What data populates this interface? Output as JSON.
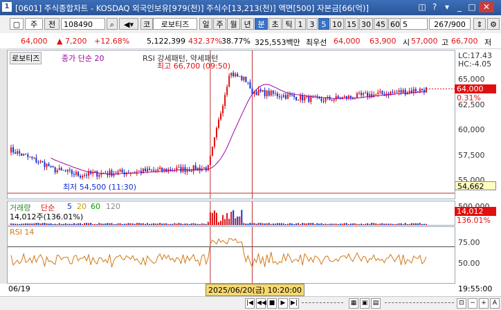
{
  "window": {
    "badge": "1",
    "title": "[0601] 주식종합차트 - KOSDAQ 외국인보유[979(천)] 주식수[13,213(천)] 액면[500] 자본금[66(억)]",
    "close": "✕"
  },
  "toolbar": {
    "market": "주",
    "market_btn": "전",
    "code": "108490",
    "stock_prefix": "코",
    "stock_name": "로보티즈",
    "periods": [
      "일",
      "주",
      "월",
      "년",
      "분",
      "초",
      "틱"
    ],
    "active_period": "분",
    "intervals": [
      "1",
      "3",
      "5",
      "10",
      "15",
      "30",
      "45",
      "60"
    ],
    "active_interval": "5",
    "interval_select": "5",
    "count": "267/900"
  },
  "quote": {
    "price": "64,000",
    "change": "▲ 7,200",
    "change_pct": "+12.68%",
    "volume": "5,122,399",
    "vol_ratio": "432.37%",
    "turnover": "38.77%",
    "amount": "325,553백만",
    "best_label": "최우선",
    "ask": "64,000",
    "bid": "63,900",
    "open_label": "시",
    "open": "57,000",
    "high_label": "고",
    "high": "66,700",
    "low_label": "저"
  },
  "price_panel": {
    "legend_name": "로보티즈",
    "legend_ma": "종가 단순 20",
    "legend_ind": "RSI 강세패턴, 약세패턴",
    "high_annot": "최고 66,700 (09:50)",
    "low_annot": "최저 54,500 (11:30)",
    "lc": "LC:17.43",
    "hc": "HC:-4.05",
    "ticks": [
      "65,000",
      "62,500",
      "60,000",
      "57,500",
      "55,000"
    ],
    "current_price": "64,000",
    "current_pct": "0.31%",
    "ref_price": "54,662",
    "up_color": "#e01010",
    "down_color": "#1030d0",
    "ma_color": "#a000a0"
  },
  "volume_panel": {
    "legend_title": "거래량",
    "legend_ma": "단순",
    "ma_periods": [
      "5",
      "20",
      "60",
      "120"
    ],
    "ma_colors": [
      "#1030d0",
      "#e0c000",
      "#00a000",
      "#888888"
    ],
    "value": "14,012주(136.01%)",
    "tag_value": "14,012",
    "tag_pct": "136.01%",
    "tick": "500,000"
  },
  "rsi_panel": {
    "legend": "RSI 14",
    "ticks": [
      "75.00",
      "50.00"
    ],
    "line_color": "#d07818"
  },
  "xaxis": {
    "start_date": "06/19",
    "crosshair": "2025/06/20(금) 10:20:00",
    "end_time": "19:55:00"
  },
  "chart_data": {
    "type": "candlestick",
    "interval_minutes": 5,
    "price_range": [
      54000,
      67500
    ],
    "high": 66700,
    "low": 54500,
    "last": 64000,
    "rsi_levels": [
      70,
      30
    ]
  }
}
